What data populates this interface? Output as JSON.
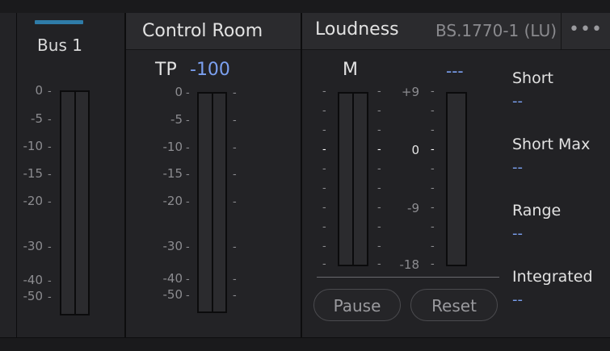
{
  "bus": {
    "title": "Bus 1",
    "color": "#2f7ca8",
    "scale": [
      "0",
      "-5",
      "-10",
      "-15",
      "-20",
      "-30",
      "-40",
      "-50"
    ]
  },
  "control_room": {
    "title": "Control Room",
    "tp_label": "TP",
    "tp_value": "-100",
    "scale": [
      "0",
      "-5",
      "-10",
      "-15",
      "-20",
      "-30",
      "-40",
      "-50"
    ]
  },
  "loudness": {
    "title": "Loudness",
    "standard": "BS.1770-1 (LU)",
    "more": "•••",
    "m_label": "M",
    "m_value": "---",
    "lu_scale": [
      "+9",
      "0",
      "-9",
      "-18"
    ],
    "stats": [
      {
        "label": "Short",
        "value": "--"
      },
      {
        "label": "Short Max",
        "value": "--"
      },
      {
        "label": "Range",
        "value": "--"
      },
      {
        "label": "Integrated",
        "value": "--"
      }
    ],
    "pause_label": "Pause",
    "reset_label": "Reset"
  }
}
